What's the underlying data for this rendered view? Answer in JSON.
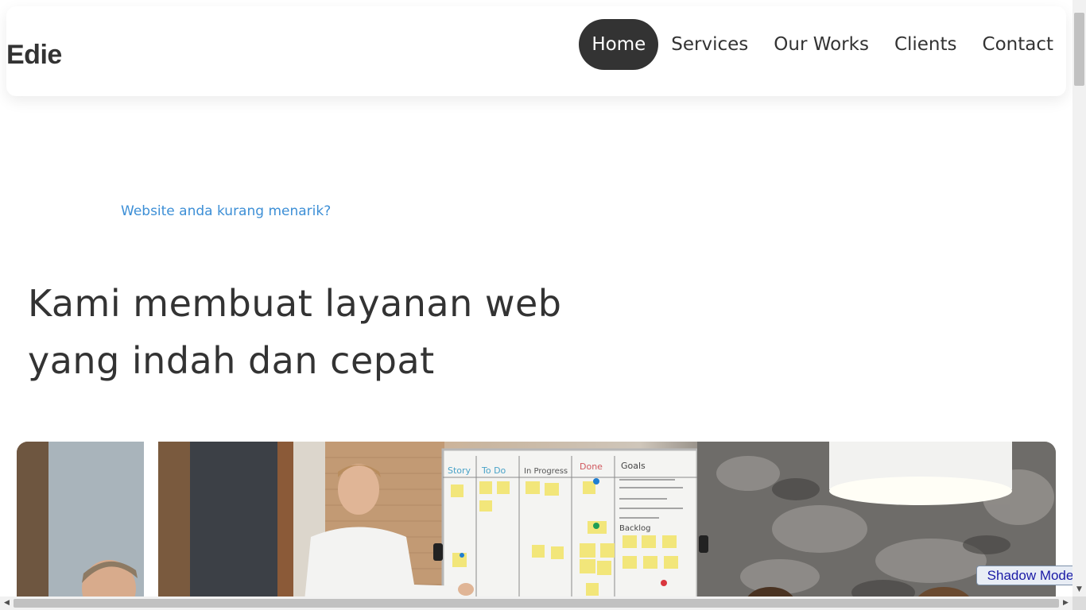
{
  "brand": {
    "name": "Edie"
  },
  "nav": {
    "items": [
      {
        "label": "Home",
        "active": true
      },
      {
        "label": "Services",
        "active": false
      },
      {
        "label": "Our Works",
        "active": false
      },
      {
        "label": "Clients",
        "active": false
      },
      {
        "label": "Contact",
        "active": false
      }
    ]
  },
  "hero": {
    "tagline": "Website anda kurang menarik?",
    "headline_line1": "Kami membuat layanan web",
    "headline_line2": "yang indah dan cepat"
  },
  "whiteboard": {
    "columns": [
      "Story",
      "To Do",
      "In Progress",
      "Done",
      "Goals"
    ],
    "backlog_label": "Backlog"
  },
  "shadow_mode": {
    "label": "Shadow Mode"
  },
  "colors": {
    "accent": "#3d8fd6",
    "text": "#333333",
    "active_nav_bg": "#333333"
  }
}
